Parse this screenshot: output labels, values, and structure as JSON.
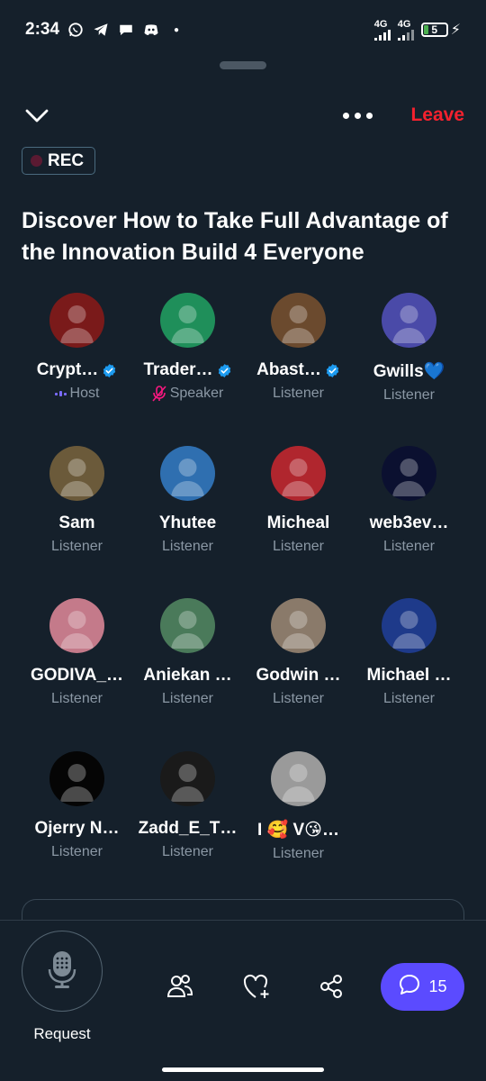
{
  "status_bar": {
    "time": "2:34",
    "net1": "4G",
    "net2": "4G",
    "battery": "5"
  },
  "header": {
    "leave_label": "Leave"
  },
  "rec_label": "REC",
  "space_title": "Discover How to Take Full Advantage of the Innovation Build 4 Everyone",
  "participants": [
    {
      "name": "Crypt…",
      "role": "Host",
      "verified": true,
      "avatar_color": "#7a1a1a"
    },
    {
      "name": "Trader…",
      "role": "Speaker",
      "verified": true,
      "avatar_color": "#1f8f5a"
    },
    {
      "name": "Abast…",
      "role": "Listener",
      "verified": true,
      "avatar_color": "#6b4a2e"
    },
    {
      "name": "Gwills💙",
      "role": "Listener",
      "verified": false,
      "avatar_color": "#4a4aa8"
    },
    {
      "name": "Sam",
      "role": "Listener",
      "verified": false,
      "avatar_color": "#6b5a3a"
    },
    {
      "name": "Yhutee",
      "role": "Listener",
      "verified": false,
      "avatar_color": "#2f6fb0"
    },
    {
      "name": "Micheal",
      "role": "Listener",
      "verified": false,
      "avatar_color": "#b0262e"
    },
    {
      "name": "web3ev…",
      "role": "Listener",
      "verified": false,
      "avatar_color": "#0b1030"
    },
    {
      "name": "GODIVA_…",
      "role": "Listener",
      "verified": false,
      "avatar_color": "#c47a8a"
    },
    {
      "name": "Aniekan …",
      "role": "Listener",
      "verified": false,
      "avatar_color": "#4a7a5a"
    },
    {
      "name": "Godwin …",
      "role": "Listener",
      "verified": false,
      "avatar_color": "#8a7a6a"
    },
    {
      "name": "Michael …",
      "role": "Listener",
      "verified": false,
      "avatar_color": "#1e3a8a"
    },
    {
      "name": "Ojerry N…",
      "role": "Listener",
      "verified": false,
      "avatar_color": "#050505"
    },
    {
      "name": "Zadd_E_T…",
      "role": "Listener",
      "verified": false,
      "avatar_color": "#1a1a1a"
    },
    {
      "name": "I 🥰 V😘…",
      "role": "Listener",
      "verified": false,
      "avatar_color": "#9a9a9a"
    }
  ],
  "bottom_bar": {
    "request_label": "Request",
    "chat_count": "15"
  },
  "colors": {
    "background": "#15202b",
    "leave": "#f4212e",
    "chat_button": "#5b4bff",
    "verified": "#1d9bf0",
    "muted_text": "#8b98a5"
  }
}
